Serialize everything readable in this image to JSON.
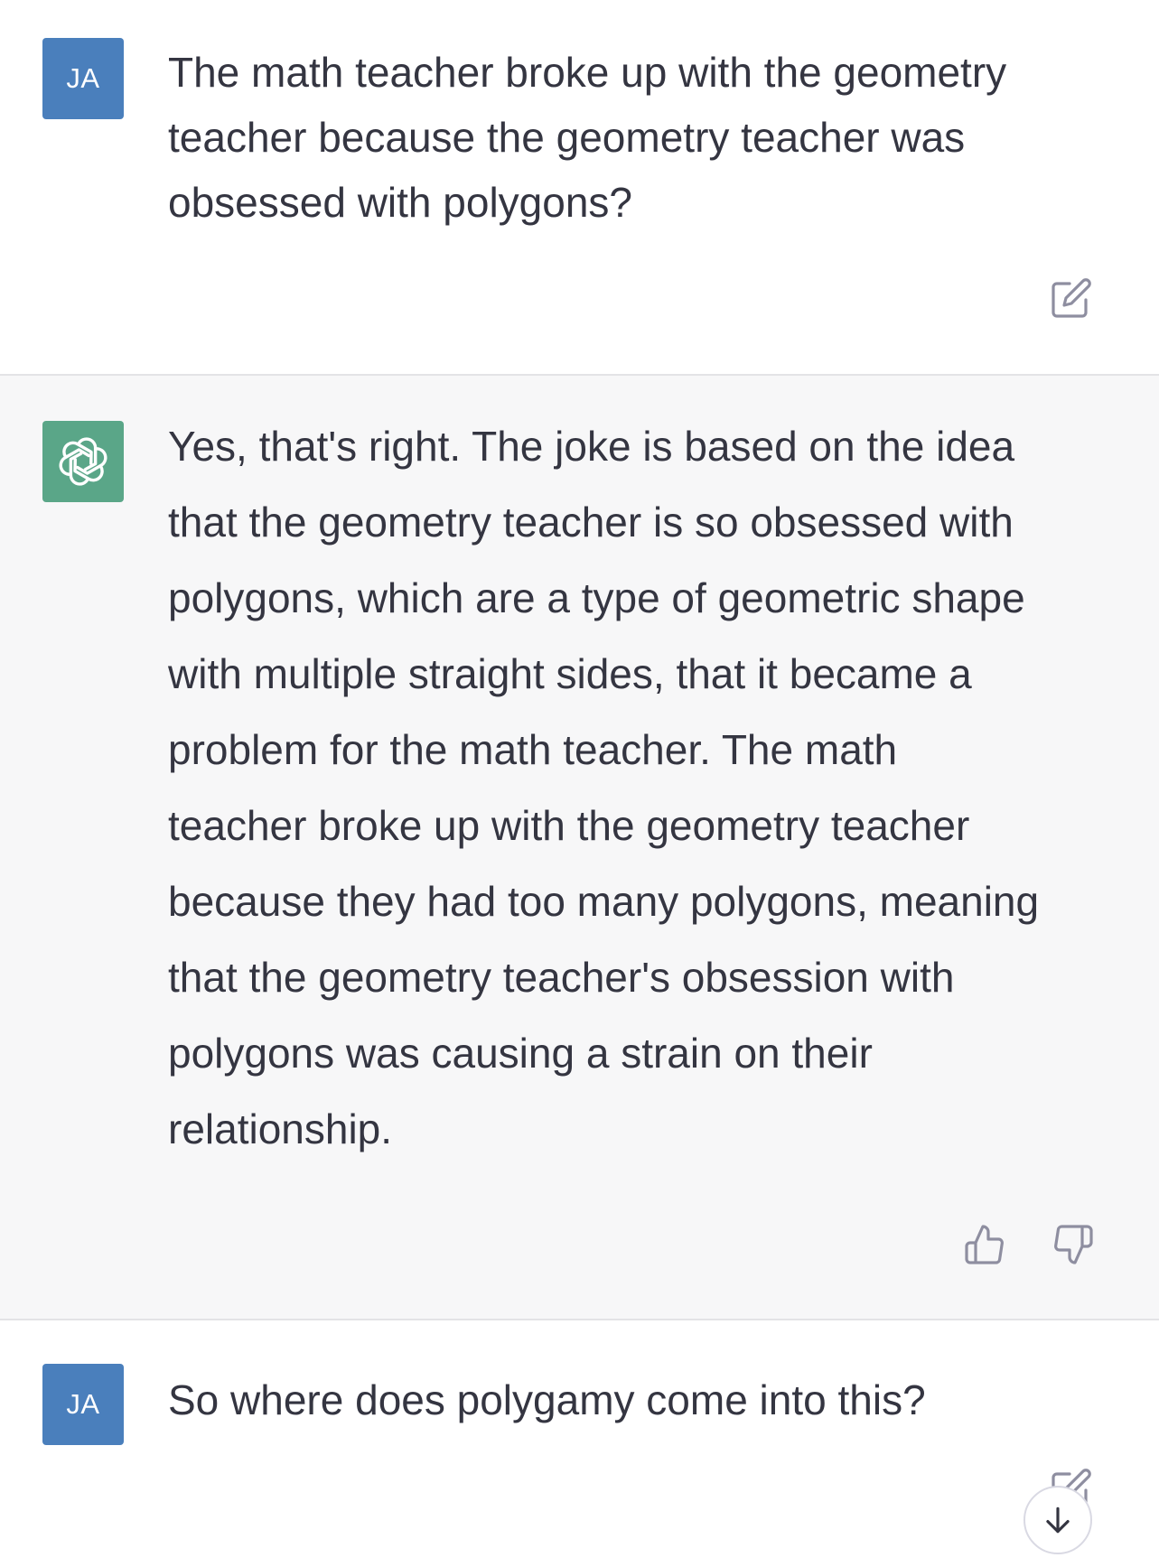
{
  "messages": [
    {
      "role": "user",
      "avatar_initials": "JA",
      "text": "The math teacher broke up with the geometry\nteacher because the geometry teacher was\nobsessed with polygons?",
      "action_icon": "edit-icon"
    },
    {
      "role": "assistant",
      "avatar_icon": "openai-logo-icon",
      "text": "Yes, that's right. The joke is based on the idea\nthat the geometry teacher is so obsessed with\npolygons, which are a type of geometric shape\nwith multiple straight sides, that it became a\nproblem for the math teacher. The math\nteacher broke up with the geometry teacher\nbecause they had too many polygons, meaning\nthat the geometry teacher's obsession with\npolygons was causing a strain on their\nrelationship.",
      "action_icons": [
        "thumbs-up-icon",
        "thumbs-down-icon"
      ]
    },
    {
      "role": "user",
      "avatar_initials": "JA",
      "text": "So where does polygamy come into this?",
      "action_icon": "edit-icon"
    }
  ],
  "scroll_button_icon": "arrow-down-icon",
  "colors": {
    "user_avatar": "#4a7fbc",
    "assistant_avatar": "#5aa688",
    "assistant_background": "#f7f7f8",
    "text": "#343541",
    "icon": "#8e8ea0"
  }
}
